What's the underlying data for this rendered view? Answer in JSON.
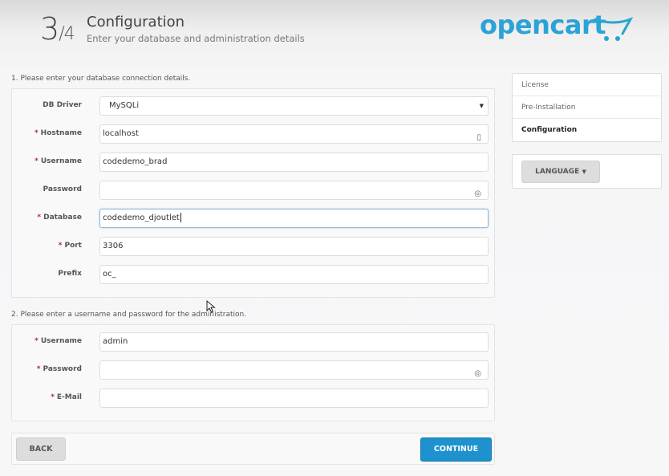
{
  "header": {
    "step_current": "3",
    "step_total": "/4",
    "title": "Configuration",
    "subtitle": "Enter your database and administration details",
    "logo_text": "opencart",
    "brand_color": "#2aa3d6"
  },
  "database_section": {
    "heading": "1. Please enter your database connection details.",
    "fields": [
      {
        "label": "DB Driver",
        "required": false,
        "value": "MySQLi",
        "type": "select"
      },
      {
        "label": "Hostname",
        "required": true,
        "value": "localhost",
        "icon": "key-card-icon"
      },
      {
        "label": "Username",
        "required": true,
        "value": "codedemo_brad"
      },
      {
        "label": "Password",
        "required": false,
        "value": "",
        "icon": "password-reveal-icon"
      },
      {
        "label": "Database",
        "required": true,
        "value": "codedemo_djoutlet",
        "focused": true
      },
      {
        "label": "Port",
        "required": true,
        "value": "3306"
      },
      {
        "label": "Prefix",
        "required": false,
        "value": "oc_"
      }
    ]
  },
  "admin_section": {
    "heading": "2. Please enter a username and password for the administration.",
    "fields": [
      {
        "label": "Username",
        "required": true,
        "value": "admin"
      },
      {
        "label": "Password",
        "required": true,
        "value": "",
        "icon": "password-reveal-icon"
      },
      {
        "label": "E-Mail",
        "required": true,
        "value": ""
      }
    ]
  },
  "sidebar": {
    "steps": [
      {
        "label": "License",
        "active": false
      },
      {
        "label": "Pre-Installation",
        "active": false
      },
      {
        "label": "Configuration",
        "active": true
      }
    ],
    "language_button": "LANGUAGE"
  },
  "footer": {
    "back_label": "BACK",
    "continue_label": "CONTINUE",
    "continue_color": "#1e91cf"
  },
  "required_marker": "*"
}
